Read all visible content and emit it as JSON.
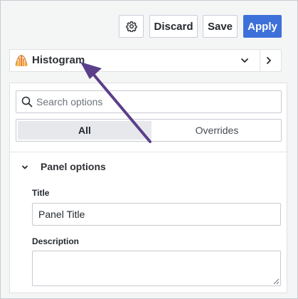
{
  "toolbar": {
    "settings_icon": "gear-icon",
    "discard_label": "Discard",
    "save_label": "Save",
    "apply_label": "Apply",
    "apply_color": "#3d71d9"
  },
  "visualization": {
    "icon": "histogram-icon",
    "name": "Histogram",
    "dropdown_icon": "chevron-down-icon",
    "next_icon": "chevron-right-icon"
  },
  "options": {
    "search": {
      "icon": "search-icon",
      "placeholder": "Search options",
      "value": ""
    },
    "tabs": [
      {
        "label": "All",
        "selected": true
      },
      {
        "label": "Overrides",
        "selected": false
      }
    ],
    "section": {
      "title": "Panel options",
      "expanded": true,
      "chevron_icon": "chevron-down-icon"
    },
    "fields": {
      "title_label": "Title",
      "title_value": "Panel Title",
      "description_label": "Description",
      "description_value": ""
    }
  },
  "annotation": {
    "arrow_color": "#5b3f8a"
  }
}
